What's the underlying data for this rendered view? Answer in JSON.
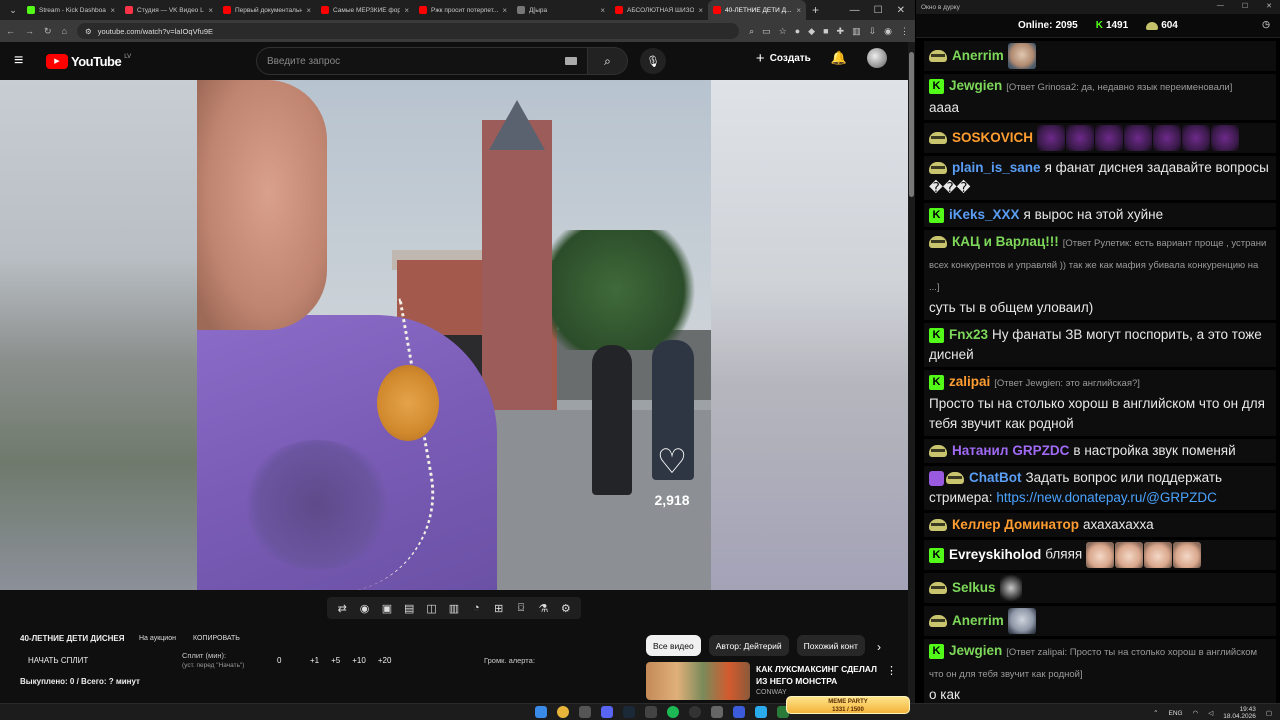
{
  "browser": {
    "tabs": [
      {
        "title": "Stream - Kick Dashboard",
        "color": "#53fc18"
      },
      {
        "title": "Студия — VK Видео Li...",
        "color": "#ff3347"
      },
      {
        "title": "Первый документальн...",
        "color": "#ff0000"
      },
      {
        "title": "Самые МЕРЗКИЕ фору...",
        "color": "#ff0000"
      },
      {
        "title": "Ржк просит потерпет...",
        "color": "#ff0000"
      },
      {
        "title": "Д[ыра",
        "color": "#777777"
      },
      {
        "title": "АБСОЛЮТНАЯ ШИЗО...",
        "color": "#ff0000"
      },
      {
        "title": "40-ЛЕТНИЕ ДЕТИ Д...",
        "color": "#ff0000",
        "active": true
      }
    ],
    "url": "youtube.com/watch?v=laIOqVfu9E"
  },
  "youtube": {
    "logo": "YouTube",
    "country": "LV",
    "search_placeholder": "Введите запрос",
    "create_label": "Создать",
    "likes": "2,918"
  },
  "extension": {
    "title": "40-ЛЕТНИЕ ДЕТИ ДИСНЕЯ",
    "auction": "На аукцион",
    "copy": "КОПИРОВАТЬ",
    "start_split": "НАЧАТЬ СПЛИТ",
    "split_label": "Сплит (мин):",
    "split_sub": "(уст. перед \"Начать\")",
    "split_value": "0",
    "increments": [
      "+1",
      "+5",
      "+10",
      "+20"
    ],
    "alert_volume": "Громк. алерта:",
    "sold": "Выкуплено: 0 / Всего: ? минут"
  },
  "chips": [
    "Все видео",
    "Автор: Дейтерий",
    "Похожий конт"
  ],
  "recommendation": {
    "title": "КАК ЛУКСМАКСИНГ СДЕЛАЛ ИЗ НЕГО МОНСТРА",
    "channel": "CONWAY"
  },
  "chat": {
    "window_title": "Окно в дурку",
    "online_label": "Online:",
    "online": "2095",
    "kick_count": "1491",
    "other_count": "604",
    "messages": [
      {
        "user": "Anerrim",
        "badge": "hat",
        "color": "#7dd85a",
        "reply": "",
        "text": "",
        "emotes": [
          "face1"
        ]
      },
      {
        "user": "Jewgien",
        "badge": "kick",
        "color": "#7dd85a",
        "reply": "[Ответ Grinosa2: да, недавно язык переименовали]",
        "text": "аааа"
      },
      {
        "user": "SOSKOVICH",
        "badge": "hat",
        "color": "#ff9d30",
        "reply": "",
        "text": "",
        "emotes": [
          "purple",
          "purple",
          "purple",
          "purple",
          "purple",
          "purple",
          "purple"
        ]
      },
      {
        "user": "plain_is_sane",
        "badge": "hat",
        "color": "#5a9ef5",
        "reply": "",
        "text": "я фанат диснея задавайте вопросы ���"
      },
      {
        "user": "iKeks_XXX",
        "badge": "kick",
        "color": "#5a9ef5",
        "reply": "",
        "text": "я вырос на этой хуйне"
      },
      {
        "user": "КАЦ и Варлац!!!",
        "badge": "hat",
        "color": "#7dd85a",
        "reply": "[Ответ Рулетик: есть вариант проще , устрани всех конкурентов и управляй )) так же как мафия убивала конкуренцию на ...]",
        "text": "суть ты в общем уловаил)"
      },
      {
        "user": "Fnx23",
        "badge": "kick",
        "color": "#7dd85a",
        "reply": "",
        "text": "Ну фанаты ЗВ могут поспорить, а это тоже дисней"
      },
      {
        "user": "zalipai",
        "badge": "kick",
        "color": "#ff9d30",
        "reply": "[Ответ Jewgien: это английская?]",
        "text": "Просто ты на столько хорош в английском что он для тебя звучит как родной"
      },
      {
        "user": "Натанил",
        "badge": "hat",
        "color": "#a06af5",
        "prefix": "GRPZDC",
        "reply": "",
        "text": "в настройка звук поменяй"
      },
      {
        "user": "ChatBot",
        "badge": "bot",
        "color": "#5a9ef5",
        "reply": "",
        "text": "Задать вопрос или поддержать стримера:",
        "link": "https://new.donatepay.ru/@GRPZDC"
      },
      {
        "user": "Келлер Доминатор",
        "badge": "hat",
        "color": "#ff9d30",
        "reply": "",
        "text": "ахахахахха"
      },
      {
        "user": "Evreyskiholod",
        "badge": "kick",
        "color": "#ffffff",
        "reply": "",
        "text": "бляяя",
        "emotes": [
          "cat",
          "cat",
          "cat",
          "cat"
        ]
      },
      {
        "user": "Selkus",
        "badge": "hat",
        "color": "#7dd85a",
        "reply": "",
        "text": "",
        "emotes": [
          "dark"
        ]
      },
      {
        "user": "Anerrim",
        "badge": "hat",
        "color": "#7dd85a",
        "reply": "",
        "text": "",
        "emotes": [
          "face2"
        ]
      },
      {
        "user": "Jewgien",
        "badge": "kick",
        "color": "#7dd85a",
        "reply": "[Ответ zalipai: Просто ты на столько хорош в английском что он для тебя звучит как родной]",
        "text": "о как"
      }
    ]
  },
  "taskbar": {
    "meme_title": "MEME PARTY",
    "meme_progress": "1331 / 1500",
    "lang": "ENG",
    "time": "19:43",
    "date": "18.04.2026"
  }
}
